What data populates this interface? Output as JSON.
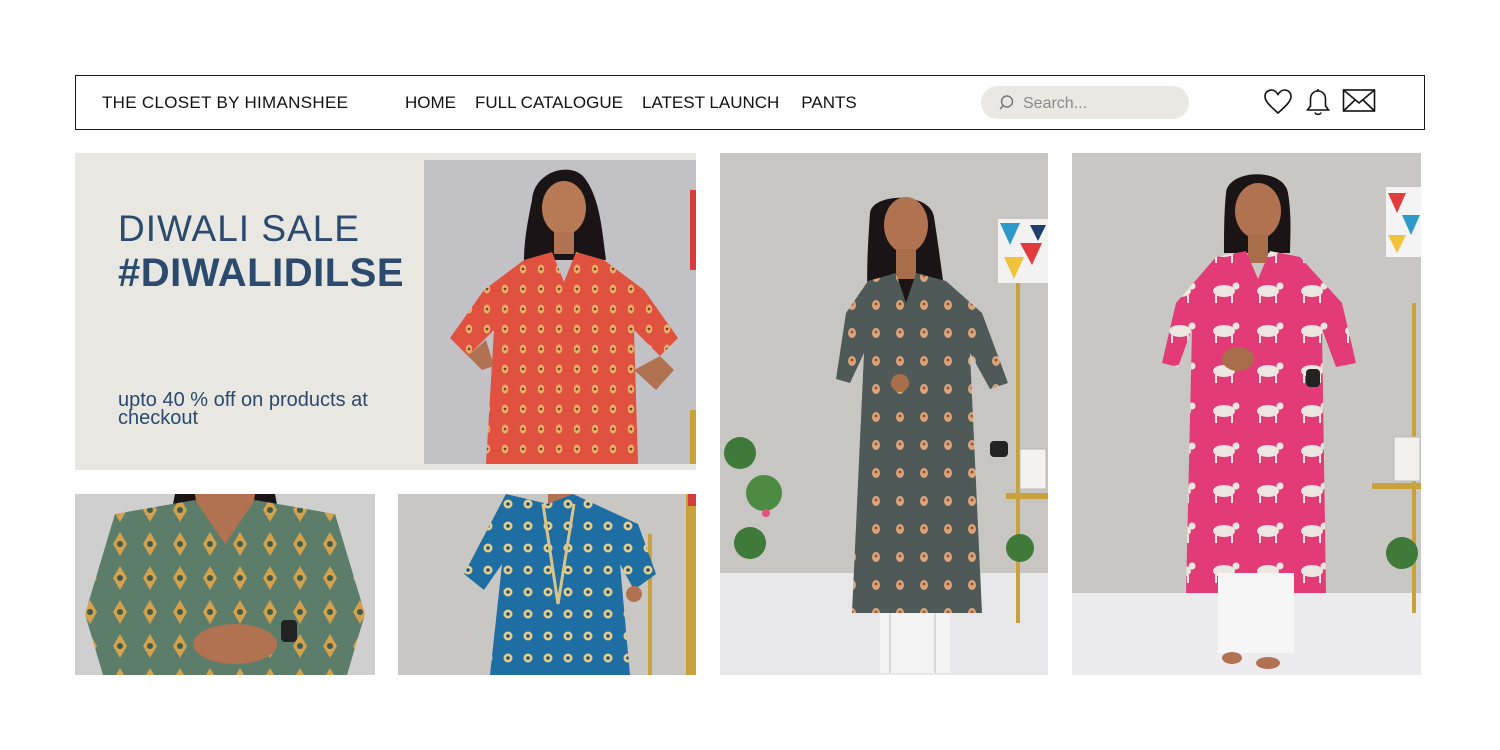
{
  "header": {
    "brand": "THE CLOSET  BY HIMANSHEE",
    "nav": [
      "HOME",
      "FULL CATALOGUE",
      "LATEST LAUNCH",
      "PANTS"
    ],
    "search": {
      "placeholder": "Search..."
    },
    "icons": [
      "search-icon",
      "heart-icon",
      "bell-icon",
      "mail-icon"
    ]
  },
  "hero": {
    "title": "DIWALI SALE",
    "hashtag": "#DIWALIDILSE",
    "subtitle": "upto 40 % off on products at checkout"
  },
  "colors": {
    "accent": "#2b4a6d",
    "banner_bg": "#e8e7e2",
    "search_bg": "#e9e8e3",
    "tops": [
      "#e0513f",
      "#5d7d6b",
      "#1f6ea3",
      "#4f5a58",
      "#e23b78"
    ]
  }
}
